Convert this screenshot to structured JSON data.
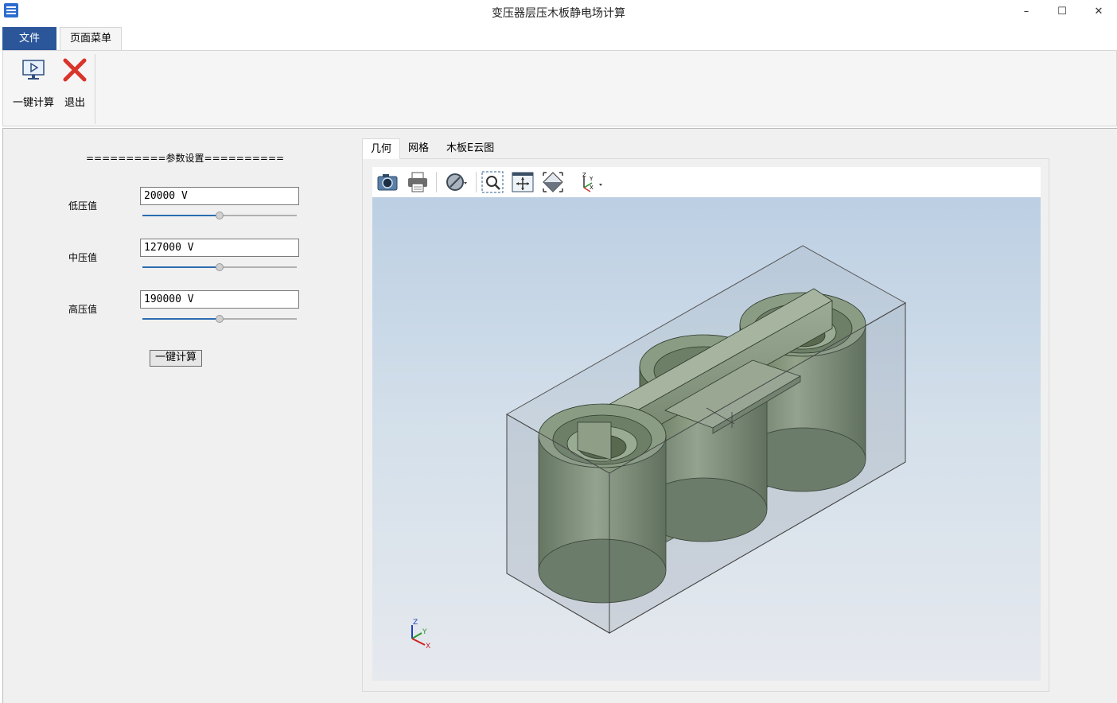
{
  "window": {
    "title": "变压器层压木板静电场计算",
    "minimize": "–",
    "maximize": "☐",
    "close": "✕"
  },
  "ribbon": {
    "tabs": [
      {
        "label": "文件"
      },
      {
        "label": "页面菜单"
      }
    ],
    "buttons": [
      {
        "label": "一键计算",
        "icon": "play-monitor-icon"
      },
      {
        "label": "退出",
        "icon": "close-x-icon"
      }
    ]
  },
  "params": {
    "title": "==========参数设置==========",
    "low": {
      "label": "低压值",
      "value": "20000 V",
      "slider_fraction": 0.5
    },
    "mid": {
      "label": "中压值",
      "value": "127000 V",
      "slider_fraction": 0.5
    },
    "high": {
      "label": "高压值",
      "value": "190000 V",
      "slider_fraction": 0.5
    },
    "calc_button": "一键计算"
  },
  "viewer": {
    "tabs": [
      {
        "label": "几何",
        "active": true
      },
      {
        "label": "网格",
        "active": false
      },
      {
        "label": "木板E云图",
        "active": false
      }
    ],
    "toolbar_icons": [
      "camera-icon",
      "print-icon",
      "display-mode-icon",
      "zoom-window-icon",
      "fit-all-icon",
      "view-iso-icon",
      "axis-view-icon"
    ],
    "triad": {
      "z": "Z",
      "y": "Y",
      "x": "X"
    }
  },
  "colors": {
    "accent": "#2b579a",
    "model_green": "#7a8c74",
    "viewport_top": "#bccfe3",
    "viewport_bottom": "#e6e9ee"
  }
}
